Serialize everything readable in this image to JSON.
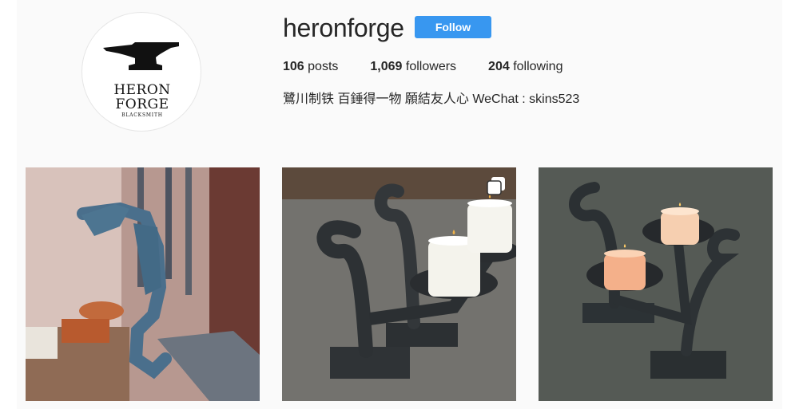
{
  "profile": {
    "username": "heronforge",
    "follow_label": "Follow",
    "avatar_logo": {
      "line1": "HERON",
      "line2": "FORGE",
      "line3": "BLACKSMITH"
    },
    "stats": {
      "posts_count": "106",
      "posts_label": "posts",
      "followers_count": "1,069",
      "followers_label": "followers",
      "following_count": "204",
      "following_label": "following"
    },
    "bio": "鷺川制铁 百錘得一物 願結友人心 WeChat : skins523"
  },
  "posts": [
    {
      "subject": "forged horse-head hook in workshop",
      "multi": false
    },
    {
      "subject": "scroll candle holder with two candles",
      "multi": true,
      "icon": "multiple-images-icon"
    },
    {
      "subject": "scroll candle holder with two lit candles",
      "multi": false
    }
  ],
  "colors": {
    "accent": "#3897f0",
    "panel": "#fafafa"
  }
}
